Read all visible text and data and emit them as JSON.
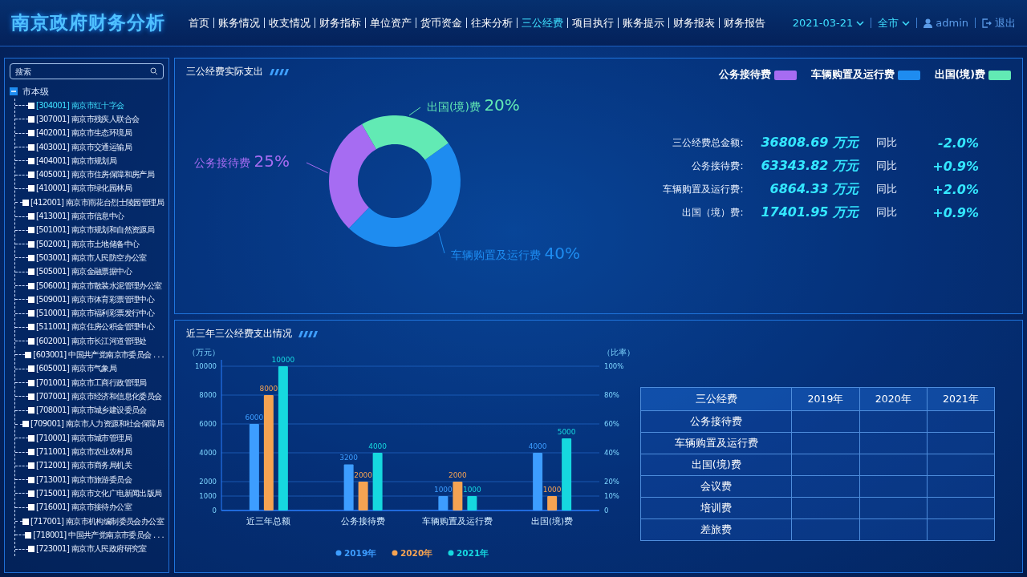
{
  "header": {
    "title": "南京政府财务分析",
    "nav": [
      {
        "label": "首页",
        "selected": false
      },
      {
        "label": "账务情况",
        "selected": false
      },
      {
        "label": "收支情况",
        "selected": false
      },
      {
        "label": "财务指标",
        "selected": false
      },
      {
        "label": "单位资产",
        "selected": false
      },
      {
        "label": "货币资金",
        "selected": false
      },
      {
        "label": "往来分析",
        "selected": false
      },
      {
        "label": "三公经费",
        "selected": true
      },
      {
        "label": "项目执行",
        "selected": false
      },
      {
        "label": "账务提示",
        "selected": false
      },
      {
        "label": "财务报表",
        "selected": false
      },
      {
        "label": "财务报告",
        "selected": false
      }
    ],
    "date": "2021-03-21",
    "region": "全市",
    "user": "admin",
    "logout": "退出"
  },
  "sidebar": {
    "search": {
      "placeholder": "搜索"
    },
    "tree": [
      {
        "label": "市本级",
        "expanded": true,
        "children": [
          {
            "label": "[304001] 南京市红十字会",
            "selected": true,
            "checked": false
          },
          {
            "label": "[307001] 南京市残疾人联合会",
            "selected": false,
            "checked": false
          },
          {
            "label": "[402001] 南京市生态环境局",
            "selected": false,
            "checked": false
          },
          {
            "label": "[403001] 南京市交通运输局",
            "selected": false,
            "checked": false
          },
          {
            "label": "[404001] 南京市规划局",
            "selected": false,
            "checked": false
          },
          {
            "label": "[405001] 南京市住房保障和房产局",
            "selected": false,
            "checked": false
          },
          {
            "label": "[410001] 南京市绿化园林局",
            "selected": false,
            "checked": false
          },
          {
            "label": "[412001] 南京市雨花台烈士陵园管理局",
            "selected": false,
            "checked": false
          },
          {
            "label": "[413001] 南京市信息中心",
            "selected": false,
            "checked": false
          },
          {
            "label": "[501001] 南京市规划和自然资源局",
            "selected": false,
            "checked": false
          },
          {
            "label": "[502001] 南京市土地储备中心",
            "selected": false,
            "checked": false
          },
          {
            "label": "[503001] 南京市人民防空办公室",
            "selected": false,
            "checked": false
          },
          {
            "label": "[505001] 南京金融票据中心",
            "selected": false,
            "checked": false
          },
          {
            "label": "[506001] 南京市散装水泥管理办公室",
            "selected": false,
            "checked": false
          },
          {
            "label": "[509001] 南京市体育彩票管理中心",
            "selected": false,
            "checked": false
          },
          {
            "label": "[510001] 南京市福利彩票发行中心",
            "selected": false,
            "checked": false
          },
          {
            "label": "[511001] 南京住房公积金管理中心",
            "selected": false,
            "checked": false
          },
          {
            "label": "[602001] 南京市长江河道管理处",
            "selected": false,
            "checked": false
          },
          {
            "label": "[603001] 中国共产党南京市委员会 . . .",
            "selected": false,
            "checked": false
          },
          {
            "label": "[605001] 南京市气象局",
            "selected": false,
            "checked": false
          },
          {
            "label": "[701001] 南京市工商行政管理局",
            "selected": false,
            "checked": false
          },
          {
            "label": "[707001] 南京市经济和信息化委员会",
            "selected": false,
            "checked": false
          },
          {
            "label": "[708001] 南京市城乡建设委员会",
            "selected": false,
            "checked": false
          },
          {
            "label": "[709001] 南京市人力资源和社会保障局",
            "selected": false,
            "checked": false
          },
          {
            "label": "[710001] 南京市城市管理局",
            "selected": false,
            "checked": false
          },
          {
            "label": "[711001] 南京市农业农村局",
            "selected": false,
            "checked": false
          },
          {
            "label": "[712001] 南京市商务局机关",
            "selected": false,
            "checked": false
          },
          {
            "label": "[713001] 南京市旅游委员会",
            "selected": false,
            "checked": false
          },
          {
            "label": "[715001] 南京市文化广电新闻出版局",
            "selected": false,
            "checked": false
          },
          {
            "label": "[716001] 南京市接待办公室",
            "selected": false,
            "checked": false
          },
          {
            "label": "[717001] 南京市机构编制委员会办公室",
            "selected": false,
            "checked": false
          },
          {
            "label": "[718001] 中国共产党南京市委员会 . . .",
            "selected": false,
            "checked": false
          },
          {
            "label": "[723001] 南京市人民政府研究室",
            "selected": false,
            "checked": false
          }
        ]
      }
    ]
  },
  "spending_panel": {
    "title": "三公经费实际支出",
    "chart_data": {
      "type": "donut",
      "categories": [
        "公务接待费",
        "车辆购置及运行费",
        "出国(境)费"
      ],
      "colors": [
        "#a66cf2",
        "#1e8cf0",
        "#62eab4"
      ],
      "values": [
        25,
        40,
        20
      ],
      "value_labels": [
        "25%",
        "40%",
        "20%"
      ]
    },
    "stats": [
      {
        "label": "三公经费总金额:",
        "amount": "36808.69 万元",
        "compare": "同比",
        "change": "-2.0%"
      },
      {
        "label": "公务接待费:",
        "amount": "63343.82 万元",
        "compare": "同比",
        "change": "+0.9%"
      },
      {
        "label": "车辆购置及运行费:",
        "amount": "6864.33 万元",
        "compare": "同比",
        "change": "+2.0%"
      },
      {
        "label": "出国（境）费:",
        "amount": "17401.95 万元",
        "compare": "同比",
        "change": "+0.9%"
      }
    ]
  },
  "history_panel": {
    "title": "近三年三公经费支出情况",
    "right_axis": {
      "label": "（比率）",
      "ticks": [
        "100%",
        "80%",
        "60%",
        "40%",
        "20%",
        "10%",
        "0"
      ]
    },
    "chart_data": {
      "type": "bar",
      "ylabel": "（万元）",
      "grid": true,
      "legend": "bottom",
      "categories": [
        "近三年总额",
        "公务接待费",
        "车辆购置及运行费",
        "出国(境)费"
      ],
      "series": [
        {
          "name": "2019年",
          "color": "#3d9dff",
          "values": [
            6000,
            3200,
            1000,
            4000
          ]
        },
        {
          "name": "2020年",
          "color": "#f5a352",
          "values": [
            8000,
            2000,
            2000,
            1000
          ]
        },
        {
          "name": "2021年",
          "color": "#16d8df",
          "values": [
            10000,
            4000,
            1000,
            5000
          ]
        }
      ],
      "ylim": [
        0,
        10000
      ],
      "yticks": [
        0,
        1000,
        2000,
        4000,
        6000,
        8000,
        10000
      ],
      "data_labels": true
    },
    "table": {
      "columns": [
        "三公经费",
        "2019年",
        "2020年",
        "2021年"
      ],
      "rows": [
        "公务接待费",
        "车辆购置及运行费",
        "出国(境)费",
        "会议费",
        "培训费",
        "差旅费"
      ]
    }
  }
}
